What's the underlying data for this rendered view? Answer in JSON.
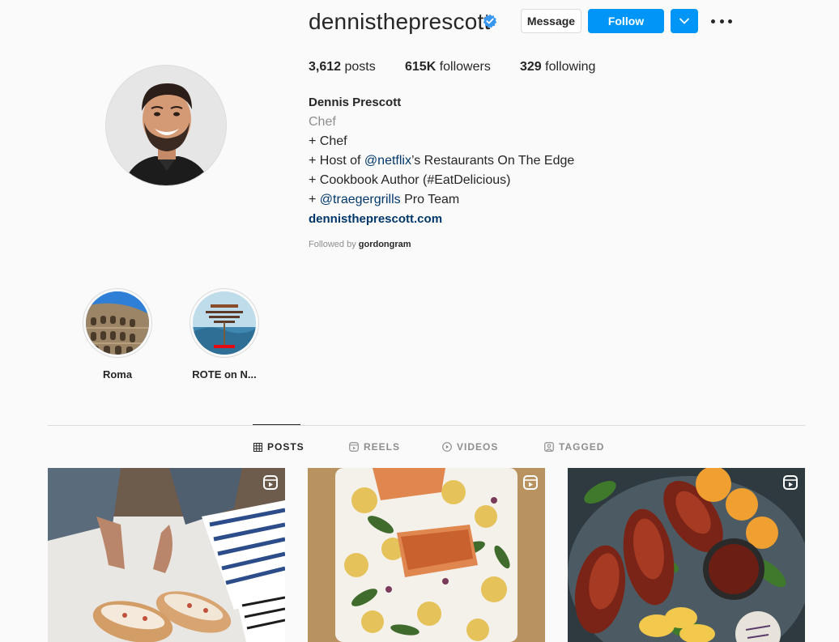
{
  "profile": {
    "username": "dennistheprescott",
    "verified": true,
    "buttons": {
      "message": "Message",
      "follow": "Follow"
    },
    "stats": {
      "posts_count": "3,612",
      "posts_label": "posts",
      "followers_count": "615K",
      "followers_label": "followers",
      "following_count": "329",
      "following_label": "following"
    },
    "bio": {
      "name": "Dennis Prescott",
      "category": "Chef",
      "line1": "+ Chef",
      "line2_prefix": "+ Host of ",
      "line2_mention": "@netflix",
      "line2_suffix": "’s Restaurants On The Edge",
      "line3": "+ Cookbook Author (#EatDelicious)",
      "line4_prefix": "+ ",
      "line4_mention": "@traegergrills",
      "line4_suffix": " Pro Team",
      "website": "dennistheprescott.com"
    },
    "followed_by": {
      "prefix": "Followed by ",
      "user": "gordongram"
    }
  },
  "highlights": [
    {
      "label": "Roma"
    },
    {
      "label": "ROTE on N..."
    }
  ],
  "tabs": [
    {
      "label": "POSTS",
      "icon": "grid-icon",
      "active": true
    },
    {
      "label": "REELS",
      "icon": "reels-icon",
      "active": false
    },
    {
      "label": "VIDEOS",
      "icon": "play-circle-icon",
      "active": false
    },
    {
      "label": "TAGGED",
      "icon": "tag-user-icon",
      "active": false
    }
  ],
  "posts": [
    {
      "type": "reel",
      "subject": "lobster-rolls"
    },
    {
      "type": "reel",
      "subject": "salmon-potatoes"
    },
    {
      "type": "reel",
      "subject": "smoked-turkey-legs"
    }
  ],
  "colors": {
    "accent": "#0095f6",
    "link": "#00376b",
    "muted": "#8e8e8e",
    "text": "#262626",
    "background": "#fafafa",
    "border": "#dbdbdb"
  }
}
